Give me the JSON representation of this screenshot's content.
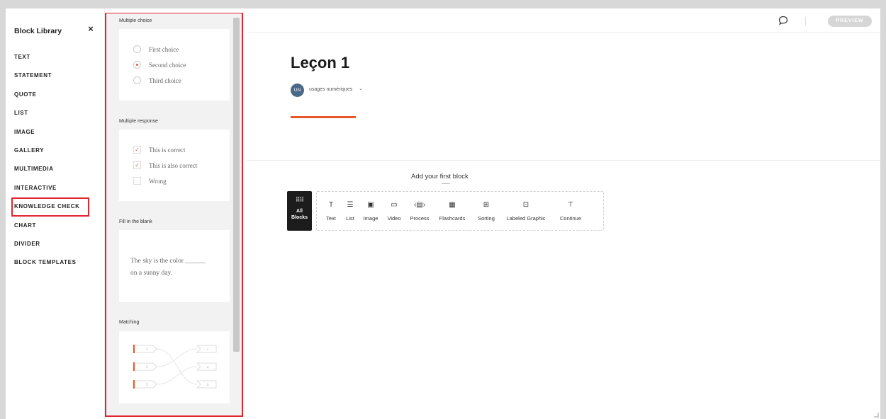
{
  "sidebar": {
    "title": "Block Library",
    "close": "×",
    "items": [
      "TEXT",
      "STATEMENT",
      "QUOTE",
      "LIST",
      "IMAGE",
      "GALLERY",
      "MULTIMEDIA",
      "INTERACTIVE",
      "KNOWLEDGE CHECK",
      "CHART",
      "DIVIDER",
      "BLOCK TEMPLATES"
    ],
    "active_index": 8
  },
  "panel": {
    "multiple_choice": {
      "title": "Multiple choice",
      "choices": [
        "First choice",
        "Second choice",
        "Third choice"
      ]
    },
    "multiple_response": {
      "title": "Multiple response",
      "choices": [
        "This is correct",
        "This is also correct",
        "Wrong"
      ]
    },
    "fill_blank": {
      "title": "Fill in the blank",
      "line1": "The sky is the color ______",
      "line2": "on a sunny day."
    },
    "matching": {
      "title": "Matching"
    }
  },
  "main": {
    "preview": "PREVIEW",
    "lesson_title": "Leçon 1",
    "author_initials": "UN",
    "author_name": "usages numériques",
    "author_chevron": "⌄",
    "add_first_block": "Add your first block",
    "all_blocks": {
      "line1": "All",
      "line2": "Blocks"
    },
    "blocks": [
      {
        "label": "Text",
        "icon": "T"
      },
      {
        "label": "List",
        "icon": "☰"
      },
      {
        "label": "Image",
        "icon": "▣"
      },
      {
        "label": "Video",
        "icon": "▭"
      },
      {
        "label": "Process",
        "icon": "‹▤›"
      },
      {
        "label": "Flashcards",
        "icon": "▦"
      },
      {
        "label": "Sorting",
        "icon": "⊞"
      },
      {
        "label": "Labeled Graphic",
        "icon": "⊡"
      },
      {
        "label": "Continue",
        "icon": "⊤"
      }
    ]
  },
  "colors": {
    "accent": "#e8572a",
    "highlight": "#e0252e",
    "dark": "#1c1c1c"
  }
}
